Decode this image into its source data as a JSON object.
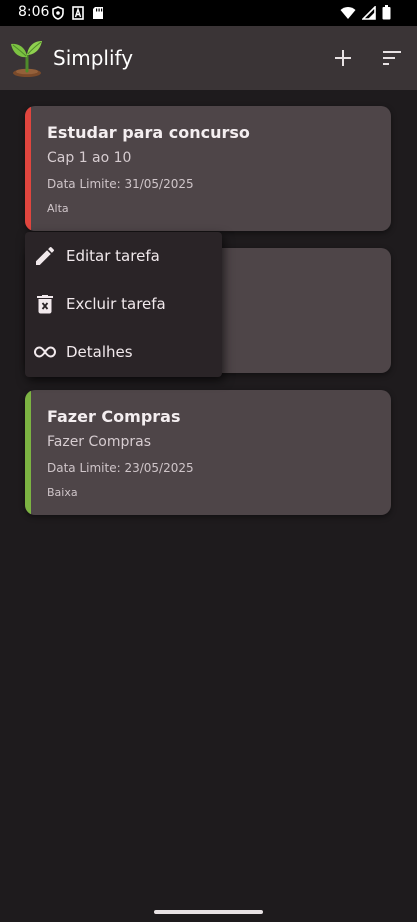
{
  "status_bar": {
    "time": "8:06"
  },
  "app_bar": {
    "title": "Simplify"
  },
  "tasks": [
    {
      "title": "Estudar para concurso",
      "description": "Cap 1 ao 10",
      "due": "Data Limite: 31/05/2025",
      "priority": "Alta",
      "priority_color": "#e0453e"
    },
    {
      "title": "",
      "description": "",
      "due": "",
      "priority": "",
      "priority_color": ""
    },
    {
      "title": "Fazer Compras",
      "description": "Fazer Compras",
      "due": "Data Limite: 23/05/2025",
      "priority": "Baixa",
      "priority_color": "#7cb342"
    }
  ],
  "context_menu": {
    "items": [
      {
        "label": "Editar tarefa",
        "icon": "pencil-icon"
      },
      {
        "label": "Excluir tarefa",
        "icon": "trash-icon"
      },
      {
        "label": "Detalhes",
        "icon": "infinity-icon"
      }
    ]
  },
  "colors": {
    "background": "#1e1b1d",
    "app_bar": "#3a3436",
    "card": "#4e4548",
    "menu": "#2a2427"
  }
}
